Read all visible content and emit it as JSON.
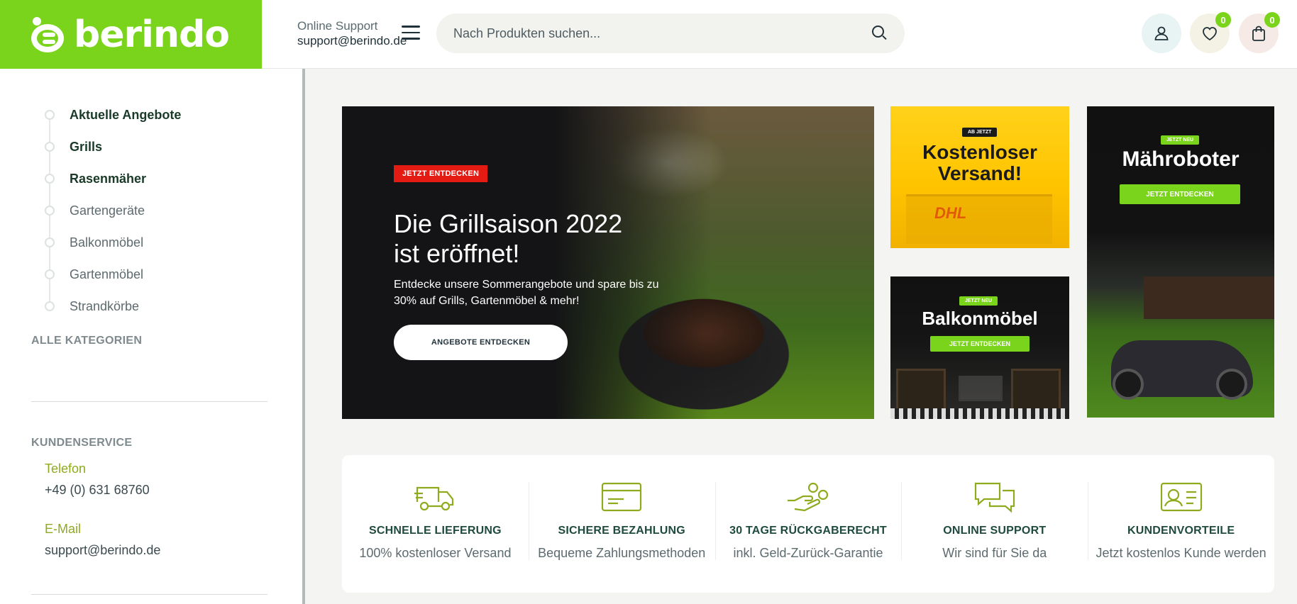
{
  "header": {
    "logo_text": "berindo",
    "support_label": "Online Support",
    "support_email": "support@berindo.de",
    "search_placeholder": "Nach Produkten suchen...",
    "wishlist_count": "0",
    "cart_count": "0",
    "brand_color": "#7bd41c"
  },
  "sidebar": {
    "categories": [
      {
        "label": "Aktuelle Angebote",
        "bold": true
      },
      {
        "label": "Grills",
        "bold": true
      },
      {
        "label": "Rasenmäher",
        "bold": true
      },
      {
        "label": "Gartengeräte",
        "bold": false
      },
      {
        "label": "Balkonmöbel",
        "bold": false
      },
      {
        "label": "Gartenmöbel",
        "bold": false
      },
      {
        "label": "Strandkörbe",
        "bold": false
      }
    ],
    "all_categories": "ALLE KATEGORIEN",
    "service_title": "KUNDENSERVICE",
    "phone_label": "Telefon",
    "phone_value": "+49 (0) 631 68760",
    "email_label": "E-Mail",
    "email_value": "support@berindo.de"
  },
  "hero": {
    "tag": "JETZT ENTDECKEN",
    "title_line1": "Die Grillsaison 2022",
    "title_line2": "ist eröffnet!",
    "subtitle": "Entdecke unsere Sommerangebote und spare bis zu 30% auf Grills, Gartenmöbel & mehr!",
    "button": "ANGEBOTE ENTDECKEN",
    "tag_color": "#e41b13"
  },
  "banners": {
    "versand": {
      "chip": "AB JETZT",
      "title_line1": "Kostenloser",
      "title_line2": "Versand!",
      "logo": "DHL"
    },
    "balkon": {
      "chip": "JETZT NEU",
      "title": "Balkonmöbel",
      "button": "JETZT ENTDECKEN"
    },
    "robot": {
      "chip": "JETZT NEU",
      "title": "Mähroboter",
      "button": "JETZT ENTDECKEN"
    }
  },
  "features": [
    {
      "icon": "delivery-truck-icon",
      "title": "SCHNELLE LIEFERUNG",
      "subtitle": "100% kostenloser Versand"
    },
    {
      "icon": "credit-card-icon",
      "title": "SICHERE BEZAHLUNG",
      "subtitle": "Bequeme Zahlungsmethoden"
    },
    {
      "icon": "money-back-icon",
      "title": "30 TAGE RÜCKGABERECHT",
      "subtitle": "inkl. Geld-Zurück-Garantie"
    },
    {
      "icon": "chat-bubbles-icon",
      "title": "ONLINE SUPPORT",
      "subtitle": "Wir sind für Sie da"
    },
    {
      "icon": "member-card-icon",
      "title": "KUNDENVORTEILE",
      "subtitle": "Jetzt kostenlos Kunde werden"
    }
  ]
}
